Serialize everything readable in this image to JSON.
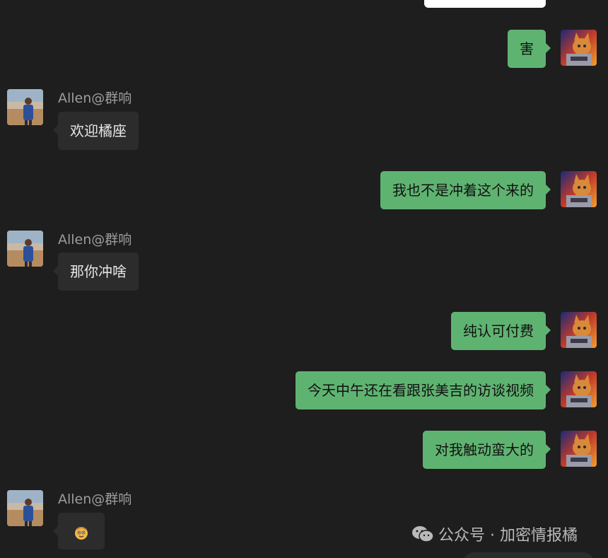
{
  "colors": {
    "background": "#1e1e1e",
    "my_bubble": "#5fb371",
    "their_bubble": "#2c2c2c",
    "sender_name": "#9c9c9c"
  },
  "messages": [
    {
      "side": "me",
      "text": "害"
    },
    {
      "side": "them",
      "sender": "Allen@群响",
      "text": "欢迎橘座"
    },
    {
      "side": "me",
      "text": "我也不是冲着这个来的"
    },
    {
      "side": "them",
      "sender": "Allen@群响",
      "text": "那你冲啥"
    },
    {
      "side": "me",
      "text": "纯认可付费"
    },
    {
      "side": "me",
      "text": "今天中午还在看跟张美吉的访谈视频"
    },
    {
      "side": "me",
      "text": "对我触动蛮大的"
    },
    {
      "side": "them",
      "sender": "Allen@群响",
      "emoji": "smile-face-emoji"
    }
  ],
  "watermark": {
    "icon": "wechat-icon",
    "text": "公众号 · 加密情报橘"
  }
}
